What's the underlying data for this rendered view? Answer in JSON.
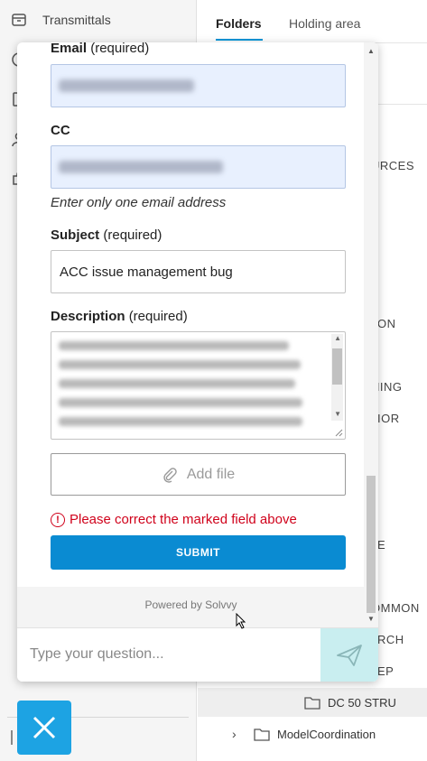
{
  "sidebar": {
    "items": [
      {
        "label": "Transmittals",
        "icon": "inbox-icon"
      },
      {
        "label": "",
        "icon": "info-icon"
      },
      {
        "label": "",
        "icon": "document-icon"
      },
      {
        "label": "",
        "icon": "user-icon"
      },
      {
        "label": "",
        "icon": "puzzle-icon"
      }
    ]
  },
  "main": {
    "tabs": [
      {
        "label": "Folders",
        "active": true
      },
      {
        "label": "Holding area",
        "active": false
      }
    ],
    "tree_fragments": [
      "URCES",
      "ON",
      "HING",
      "IOR",
      "E",
      "OMMON",
      "RCH",
      "EP"
    ],
    "tree_rows": [
      {
        "label": "DC 50 STRU"
      },
      {
        "label": "ModelCoordination"
      }
    ]
  },
  "form": {
    "email_label": "Email",
    "email_required": "(required)",
    "cc_label": "CC",
    "cc_hint": "Enter only one email address",
    "subject_label": "Subject",
    "subject_required": "(required)",
    "subject_value": "ACC issue management bug",
    "description_label": "Description",
    "description_required": "(required)",
    "add_file_label": "Add file",
    "error_text": "Please correct the marked field above",
    "submit_label": "SUBMIT",
    "powered_by": "Powered by Solvvy"
  },
  "composer": {
    "placeholder": "Type your question..."
  },
  "colors": {
    "accent": "#0a8bd2",
    "error": "#d0021b",
    "send_bg": "#c9eef0",
    "fab": "#1da3e3"
  }
}
